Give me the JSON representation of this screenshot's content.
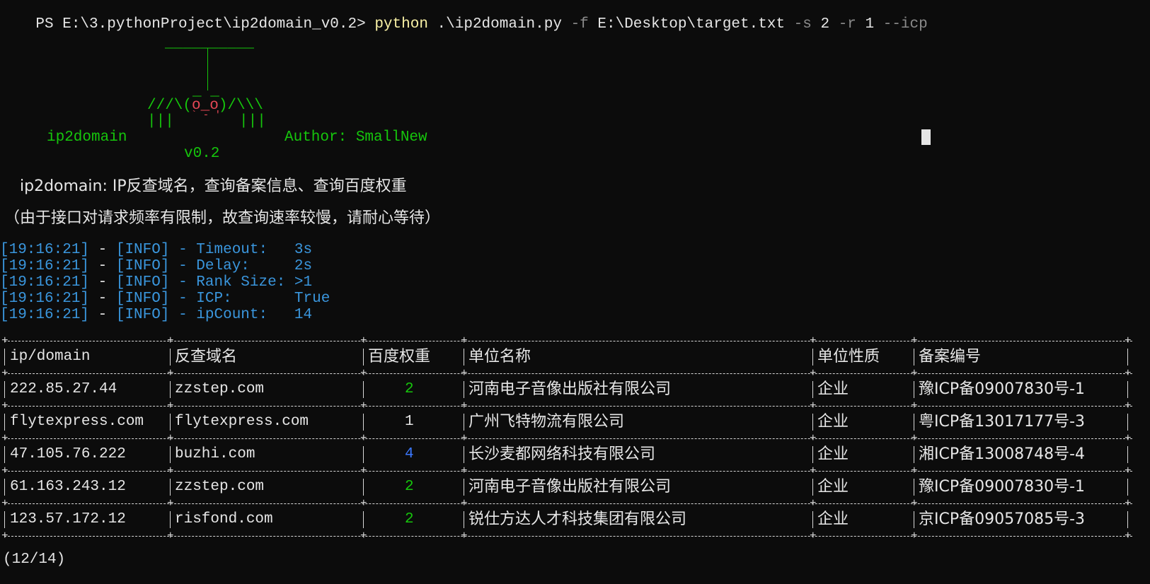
{
  "command": {
    "prompt": "PS E:\\3.pythonProject\\ip2domain_v0.2> ",
    "exe": "python",
    "script": " .\\ip2domain.py ",
    "flag_f": "-f",
    "arg_f": " E:\\Desktop\\target.txt ",
    "flag_s": "-s",
    "arg_s": " 2 ",
    "flag_r": "-r",
    "arg_r": " 1 ",
    "flag_icp": "--icp"
  },
  "banner": {
    "art_top": "__________",
    "art_pipe": "|",
    "art_head_top": "_ _",
    "art_left": "///\\(",
    "art_face": "o_o",
    "art_right": ")/\\\\\\",
    "art_legs_left": "|||",
    "art_mouth": "` - '",
    "art_legs_right": "|||",
    "name": "ip2domain",
    "author": "Author: SmallNew",
    "version": "v0.2"
  },
  "description": "ip2domain: IP反查域名，查询备案信息、查询百度权重",
  "notice": "（由于接口对请求频率有限制，故查询速率较慢，请耐心等待）",
  "log_lines": [
    {
      "time": "[19:16:21]",
      "level": "[INFO]",
      "key": "Timeout:   ",
      "value": "3s"
    },
    {
      "time": "[19:16:21]",
      "level": "[INFO]",
      "key": "Delay:     ",
      "value": "2s"
    },
    {
      "time": "[19:16:21]",
      "level": "[INFO]",
      "key": "Rank Size: ",
      "value": ">1"
    },
    {
      "time": "[19:16:21]",
      "level": "[INFO]",
      "key": "ICP:       ",
      "value": "True"
    },
    {
      "time": "[19:16:21]",
      "level": "[INFO]",
      "key": "ipCount:   ",
      "value": "14"
    }
  ],
  "log_separator": " - ",
  "table": {
    "headers": [
      "ip/domain",
      "反查域名",
      "百度权重",
      "单位名称",
      "单位性质",
      "备案编号"
    ],
    "rows": [
      {
        "ip": "222.85.27.44",
        "domain": "zzstep.com",
        "rank": "2",
        "rank_color": "#16c60c",
        "unit": "河南电子音像出版社有限公司",
        "type": "企业",
        "icp": "豫ICP备09007830号-1"
      },
      {
        "ip": "flytexpress.com",
        "domain": "flytexpress.com",
        "rank": "1",
        "rank_color": "#e6e6e6",
        "unit": "广州飞特物流有限公司",
        "type": "企业",
        "icp": "粤ICP备13017177号-3"
      },
      {
        "ip": "47.105.76.222",
        "domain": "buzhi.com",
        "rank": "4",
        "rank_color": "#3b78ff",
        "unit": "长沙麦都网络科技有限公司",
        "type": "企业",
        "icp": "湘ICP备13008748号-4"
      },
      {
        "ip": "61.163.243.12",
        "domain": "zzstep.com",
        "rank": "2",
        "rank_color": "#16c60c",
        "unit": "河南电子音像出版社有限公司",
        "type": "企业",
        "icp": "豫ICP备09007830号-1"
      },
      {
        "ip": "123.57.172.12",
        "domain": "risfond.com",
        "rank": "2",
        "rank_color": "#16c60c",
        "unit": "锐仕方达人才科技集团有限公司",
        "type": "企业",
        "icp": "京ICP备09057085号-3"
      }
    ]
  },
  "progress": "(12/14)"
}
